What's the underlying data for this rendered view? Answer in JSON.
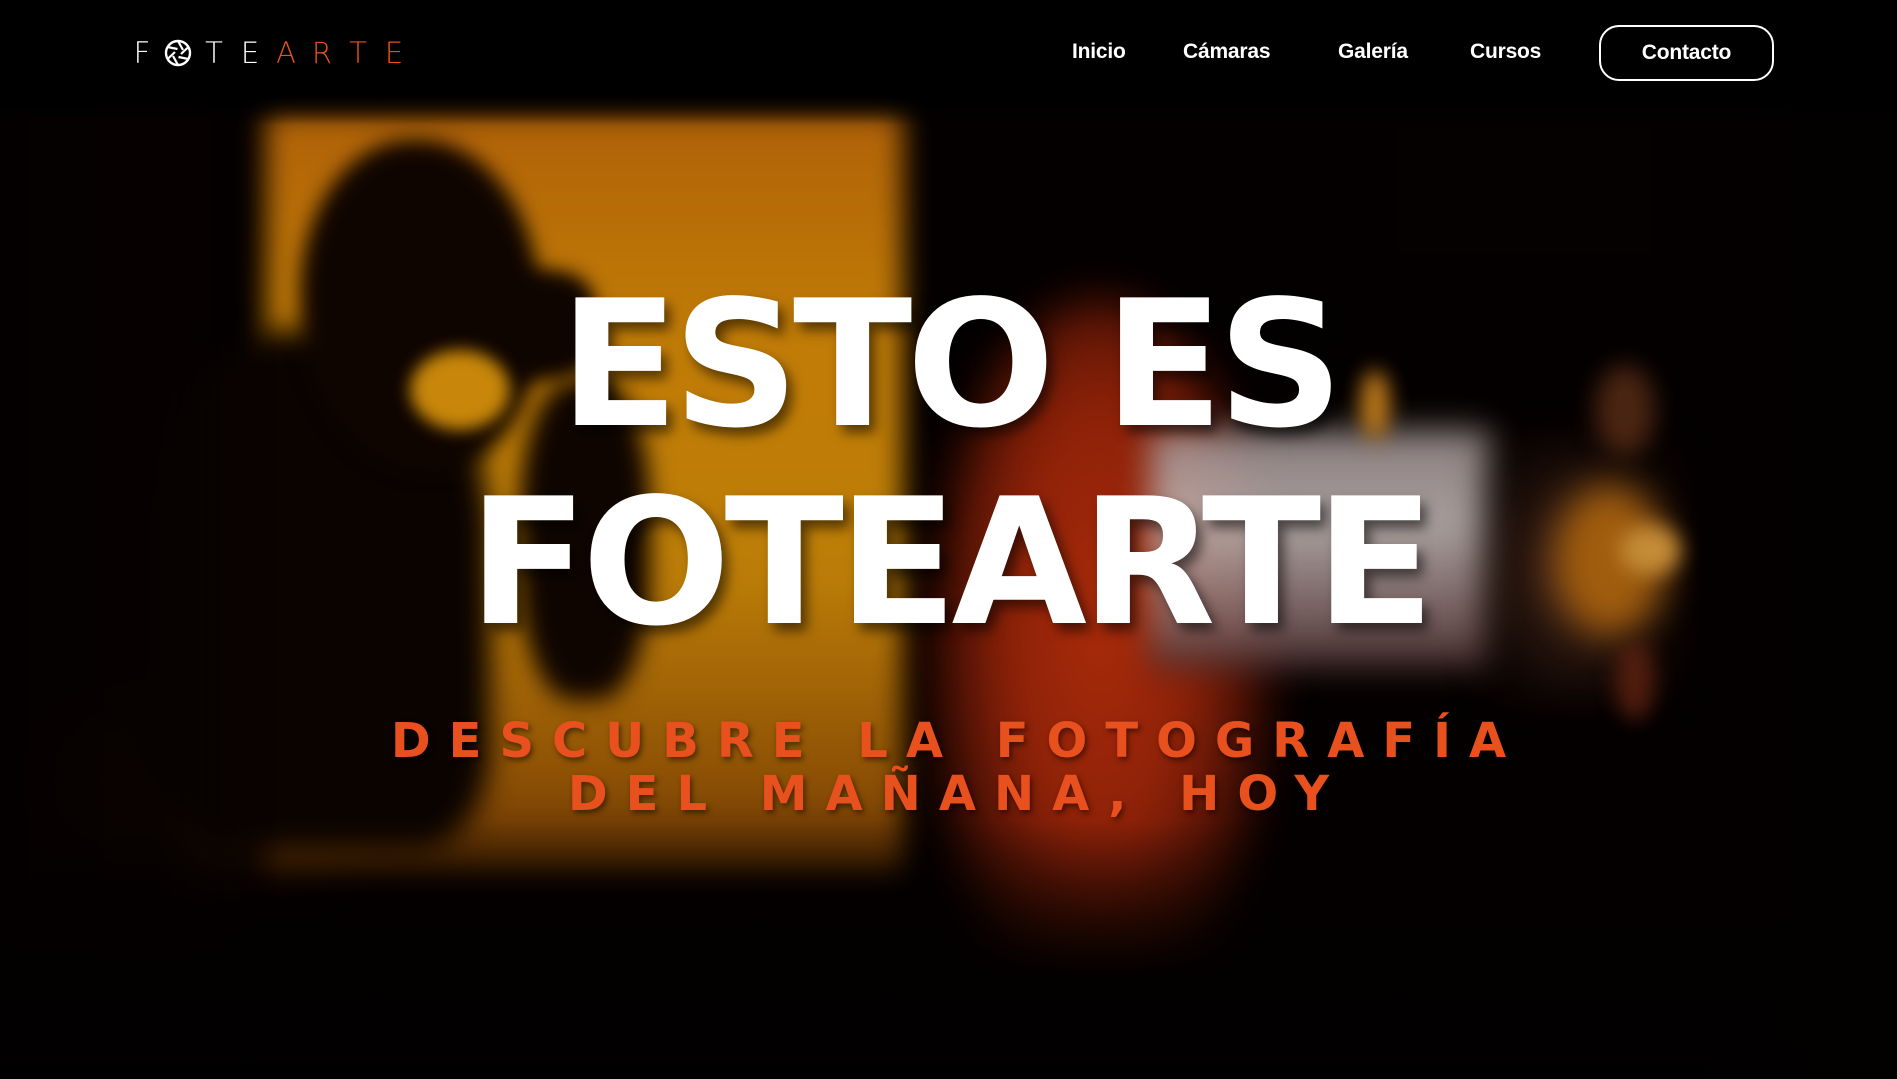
{
  "brand": {
    "logo_letters": [
      "F",
      "O",
      "T",
      "E",
      "A",
      "R",
      "T",
      "E"
    ],
    "logo_text": "FOTEARTE",
    "accent_color": "#e8501e",
    "logo_icon": "aperture-icon"
  },
  "nav": {
    "items": [
      {
        "label": "Inicio"
      },
      {
        "label": "Cámaras"
      },
      {
        "label": "Galería"
      },
      {
        "label": "Cursos"
      }
    ],
    "contact_label": "Contacto"
  },
  "hero": {
    "title_line1": "ESTO ES",
    "title_line2": "FOTEARTE",
    "subtitle_line1": "DESCUBRE LA FOTOGRAFÍA",
    "subtitle_line2": "DEL MAÑANA, HOY",
    "title_color": "#ffffff",
    "subtitle_color": "#e8501e"
  }
}
